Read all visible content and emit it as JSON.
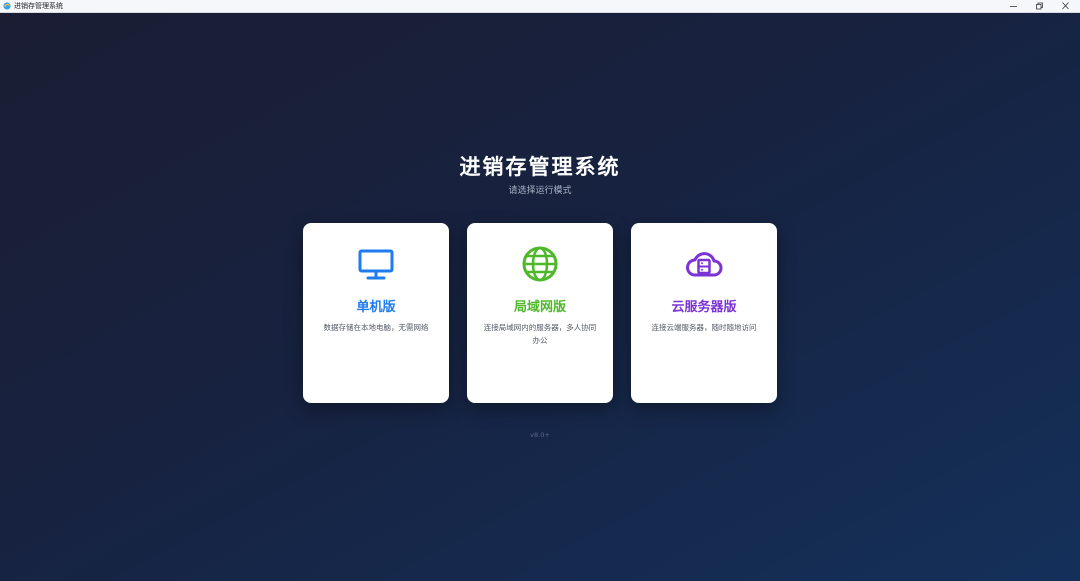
{
  "window": {
    "title": "进销存管理系统",
    "icon": "app-logo-icon",
    "controls": {
      "minimize_icon": "minimize-icon",
      "maximize_icon": "restore-icon",
      "close_icon": "close-icon"
    }
  },
  "main": {
    "title": "进销存管理系统",
    "subtitle": "请选择运行模式",
    "modes": [
      {
        "title": "单机版",
        "description": "数据存储在本地电脑，无需网络",
        "icon": "monitor-icon",
        "color": "#1e7bf0"
      },
      {
        "title": "局域网版",
        "description": "连接局域网内的服务器，多人协同办公",
        "icon": "globe-icon",
        "color": "#4fb82a"
      },
      {
        "title": "云服务器版",
        "description": "连接云端服务器，随时随地访问",
        "icon": "cloud-server-icon",
        "color": "#7b33d6"
      }
    ],
    "version": "v8.0+"
  }
}
